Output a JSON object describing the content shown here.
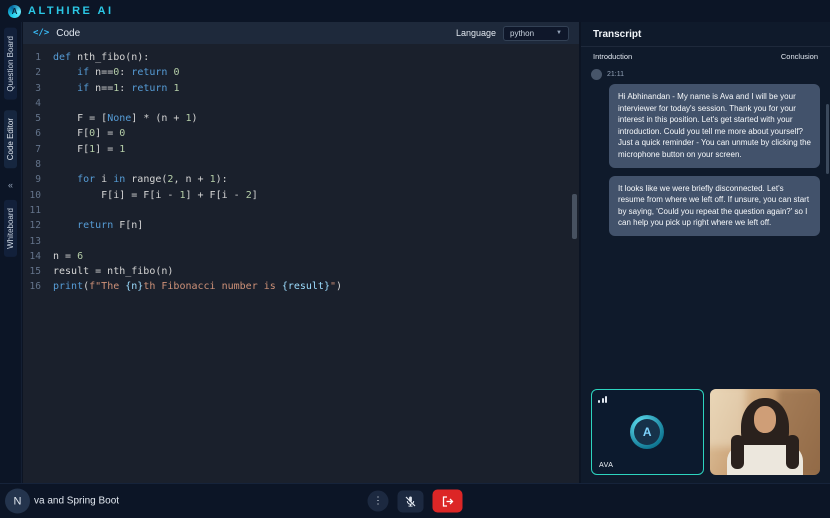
{
  "colors": {
    "accent": "#2dd4bf",
    "brand": "#2bc8e6",
    "danger": "#dc2626"
  },
  "topbar": {
    "brand": "ALTHIRE AI",
    "logo_letter": "A"
  },
  "sidebar": {
    "items": [
      {
        "label": "Question Board"
      },
      {
        "label": "Code Editor"
      },
      {
        "label": "Whiteboard"
      }
    ],
    "collapse_glyph": "«"
  },
  "editor": {
    "icon": "</>",
    "title": "Code",
    "language_label": "Language",
    "language_value": "python",
    "lines": [
      [
        [
          "kw",
          "def"
        ],
        [
          "pl",
          " nth_fibo(n):"
        ]
      ],
      [
        [
          "pl",
          "    "
        ],
        [
          "kw",
          "if"
        ],
        [
          "pl",
          " n=="
        ],
        [
          "num",
          "0"
        ],
        [
          "pl",
          ": "
        ],
        [
          "kw",
          "return"
        ],
        [
          "pl",
          " "
        ],
        [
          "num",
          "0"
        ]
      ],
      [
        [
          "pl",
          "    "
        ],
        [
          "kw",
          "if"
        ],
        [
          "pl",
          " n=="
        ],
        [
          "num",
          "1"
        ],
        [
          "pl",
          ": "
        ],
        [
          "kw",
          "return"
        ],
        [
          "pl",
          " "
        ],
        [
          "num",
          "1"
        ]
      ],
      [],
      [
        [
          "pl",
          "    F = ["
        ],
        [
          "kw",
          "None"
        ],
        [
          "pl",
          "] * (n + "
        ],
        [
          "num",
          "1"
        ],
        [
          "pl",
          ")"
        ]
      ],
      [
        [
          "pl",
          "    F["
        ],
        [
          "num",
          "0"
        ],
        [
          "pl",
          "] = "
        ],
        [
          "num",
          "0"
        ]
      ],
      [
        [
          "pl",
          "    F["
        ],
        [
          "num",
          "1"
        ],
        [
          "pl",
          "] = "
        ],
        [
          "num",
          "1"
        ]
      ],
      [],
      [
        [
          "pl",
          "    "
        ],
        [
          "kw",
          "for"
        ],
        [
          "pl",
          " i "
        ],
        [
          "kw",
          "in"
        ],
        [
          "pl",
          " range("
        ],
        [
          "num",
          "2"
        ],
        [
          "pl",
          ", n + "
        ],
        [
          "num",
          "1"
        ],
        [
          "pl",
          "):"
        ]
      ],
      [
        [
          "pl",
          "        F[i] = F[i - "
        ],
        [
          "num",
          "1"
        ],
        [
          "pl",
          "] + F[i - "
        ],
        [
          "num",
          "2"
        ],
        [
          "pl",
          "]"
        ]
      ],
      [],
      [
        [
          "pl",
          "    "
        ],
        [
          "kw",
          "return"
        ],
        [
          "pl",
          " F[n]"
        ]
      ],
      [],
      [
        [
          "pl",
          "n = "
        ],
        [
          "num",
          "6"
        ]
      ],
      [
        [
          "pl",
          "result = nth_fibo(n)"
        ]
      ],
      [
        [
          "kw",
          "print"
        ],
        [
          "pl",
          "("
        ],
        [
          "str",
          "f\"The "
        ],
        [
          "expr",
          "{n}"
        ],
        [
          "str",
          "th Fibonacci number is "
        ],
        [
          "expr",
          "{result}"
        ],
        [
          "str",
          "\""
        ],
        [
          "pl",
          ")"
        ]
      ]
    ]
  },
  "transcript": {
    "title": "Transcript",
    "stages": {
      "left": "Introduction",
      "right": "Conclusion"
    },
    "timestamp": "21:11",
    "messages": [
      {
        "text": "Hi Abhinandan - My name is Ava and I will be your interviewer for today's session. Thank you for your interest in this position. Let's get started with your introduction. Could you tell me more about yourself? Just a quick reminder - You can unmute by clicking the microphone button on your screen."
      },
      {
        "text": "It looks like we were briefly disconnected. Let's resume from where we left off. If unsure, you can start by saying, 'Could you repeat the question again?' so I can help you pick up right where we left off."
      }
    ]
  },
  "videos": {
    "ava_label": "AVA",
    "ava_logo_letter": "A"
  },
  "bottombar": {
    "avatar_initial": "N",
    "session_title": "va and Spring Boot",
    "more_glyph": "⋮"
  }
}
